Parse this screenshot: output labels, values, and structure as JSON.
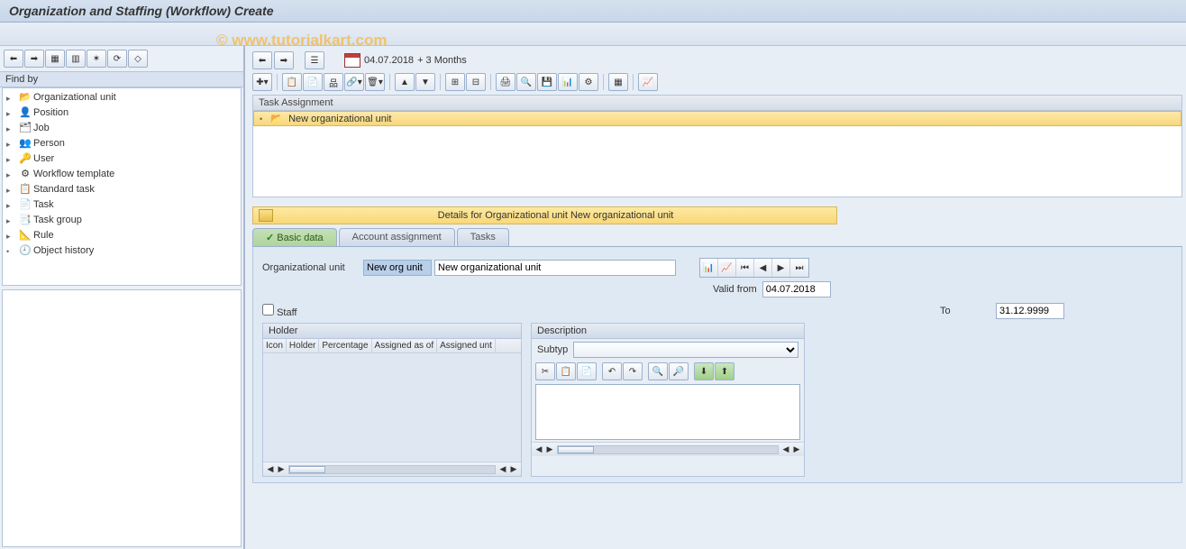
{
  "title": "Organization and Staffing (Workflow) Create",
  "watermark": "© www.tutorialkart.com",
  "left": {
    "findBy": "Find by",
    "items": [
      {
        "label": "Organizational unit",
        "icon": "📂"
      },
      {
        "label": "Position",
        "icon": "👤"
      },
      {
        "label": "Job",
        "icon": "🗂"
      },
      {
        "label": "Person",
        "icon": "👥"
      },
      {
        "label": "User",
        "icon": "🔑"
      },
      {
        "label": "Workflow template",
        "icon": "⚙"
      },
      {
        "label": "Standard task",
        "icon": "📋"
      },
      {
        "label": "Task",
        "icon": "📄"
      },
      {
        "label": "Task group",
        "icon": "📑"
      },
      {
        "label": "Rule",
        "icon": "📐"
      },
      {
        "label": "Object history",
        "icon": "🕘"
      }
    ]
  },
  "top": {
    "date": "04.07.2018",
    "period": "+ 3 Months"
  },
  "task": {
    "header": "Task Assignment",
    "item": "New organizational unit"
  },
  "details": {
    "title": "Details for Organizational unit New organizational unit",
    "tabs": {
      "basic": "Basic data",
      "account": "Account assignment",
      "tasks": "Tasks"
    },
    "org_label": "Organizational unit",
    "org_short": "New org unit",
    "org_long": "New organizational unit",
    "valid_from_label": "Valid from",
    "valid_from": "04.07.2018",
    "to_label": "To",
    "to": "31.12.9999",
    "staff": "Staff",
    "holder": {
      "title": "Holder",
      "cols": [
        "Icon",
        "Holder",
        "Percentage",
        "Assigned as of",
        "Assigned unt"
      ]
    },
    "desc": {
      "title": "Description",
      "subtyp_label": "Subtyp"
    }
  }
}
